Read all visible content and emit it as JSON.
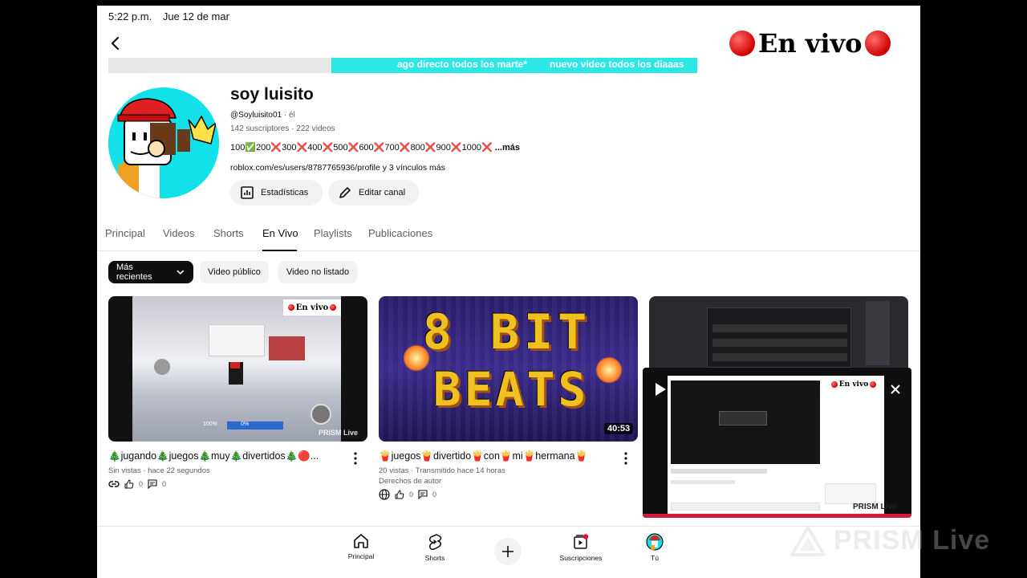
{
  "status_bar": {
    "time": "5:22 p.m.",
    "date": "Jue 12 de mar"
  },
  "overlay": {
    "title": "En vivo"
  },
  "banner": {
    "text_left": "ago directo todos los marte*",
    "text_right": "nuevo video todos los diaaas"
  },
  "channel": {
    "name": "soy luisito",
    "handle": "@Soyluisito01",
    "pronoun": "él",
    "subscribers": "142 suscriptores",
    "video_count": "222 videos",
    "description_items": [
      {
        "num": "100",
        "mark": "✅"
      },
      {
        "num": "200",
        "mark": "❌"
      },
      {
        "num": "300",
        "mark": "❌"
      },
      {
        "num": "400",
        "mark": "❌"
      },
      {
        "num": "500",
        "mark": "❌"
      },
      {
        "num": "600",
        "mark": "❌"
      },
      {
        "num": "700",
        "mark": "❌"
      },
      {
        "num": "800",
        "mark": "❌"
      },
      {
        "num": "900",
        "mark": "❌"
      },
      {
        "num": "1000",
        "mark": "❌"
      }
    ],
    "description_more": "...más",
    "links": "roblox.com/es/users/8787765936/profile y 3 vínculos más",
    "stats_button": "Estadísticas",
    "edit_button": "Editar canal"
  },
  "tabs": [
    "Principal",
    "Videos",
    "Shorts",
    "En Vivo",
    "Playlists",
    "Publicaciones"
  ],
  "active_tab": "En Vivo",
  "filters": {
    "sort": "Más recientes",
    "public": "Video público",
    "unlisted": "Video no listado"
  },
  "videos": [
    {
      "title": "🎄jugando🎄juegos🎄muy🎄divertidos🎄🔴...",
      "meta": "Sin vistas · hace 22 segundos",
      "likes": "0",
      "comments": "0",
      "thumb_live_label": "En vivo",
      "thumb_brand": "PRISM Live",
      "thumb_hud": [
        "100%",
        "0%"
      ]
    },
    {
      "title": "🍟juegos🍟divertido🍟con🍟mi🍟hermana🍟",
      "meta": "20 vistas · Transmitido hace 14 horas",
      "meta2": "Derechos de autor",
      "likes": "0",
      "comments": "0",
      "duration": "40:53",
      "thumb_line1": "8 BIT",
      "thumb_line2": "BEATS"
    }
  ],
  "miniplayer": {
    "overlay_label": "En vivo",
    "brand": "PRISM Live"
  },
  "bottom_nav": [
    {
      "label": "Principal",
      "icon": "home-icon"
    },
    {
      "label": "Shorts",
      "icon": "shorts-icon"
    },
    {
      "label": "",
      "icon": "create-icon"
    },
    {
      "label": "Suscripciones",
      "icon": "subscriptions-icon"
    },
    {
      "label": "Tú",
      "icon": "you-avatar-icon"
    }
  ],
  "watermark": {
    "text": "PRISM Live"
  },
  "colors": {
    "accent_cyan": "#2de6e6",
    "live_red": "#d00000",
    "banner_gray": "#e8e8e8"
  }
}
